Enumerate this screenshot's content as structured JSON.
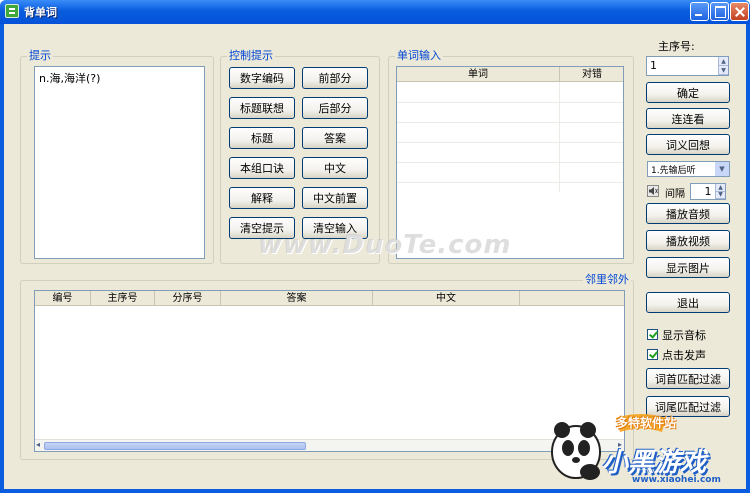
{
  "window": {
    "title": "背单词"
  },
  "hints": {
    "legend": "提示",
    "items": [
      "n.海,海洋(?)"
    ]
  },
  "control": {
    "legend": "控制提示",
    "buttons": [
      [
        "数字编码",
        "前部分"
      ],
      [
        "标题联想",
        "后部分"
      ],
      [
        "标题",
        "答案"
      ],
      [
        "本组口诀",
        "中文"
      ],
      [
        "解释",
        "中文前置"
      ],
      [
        "清空提示",
        "清空输入"
      ]
    ]
  },
  "word_input": {
    "legend": "单词输入",
    "columns": [
      "单词",
      "对错"
    ]
  },
  "right": {
    "seq_label": "主序号:",
    "seq_value": "1",
    "btn_confirm": "确定",
    "btn_link": "连连看",
    "btn_recall": "词义回想",
    "mode_select": "1.先输后听",
    "interval_label": "间隔",
    "interval_value": "1",
    "btn_audio": "播放音频",
    "btn_video": "播放视频",
    "btn_image": "显示图片",
    "btn_exit": "退出",
    "chk_phonetic": "显示音标",
    "chk_click_sound": "点击发声",
    "btn_head_filter": "词首匹配过滤",
    "btn_tail_filter": "词尾匹配过滤"
  },
  "neighbors": {
    "legend": "邻里邻外",
    "columns": [
      "编号",
      "主序号",
      "分序号",
      "答案",
      "中文"
    ]
  },
  "watermark": "www.DuoTe.com",
  "logo": {
    "top": "多特软件站",
    "main": "小黑游戏",
    "url": "www.xiaohei.com"
  }
}
